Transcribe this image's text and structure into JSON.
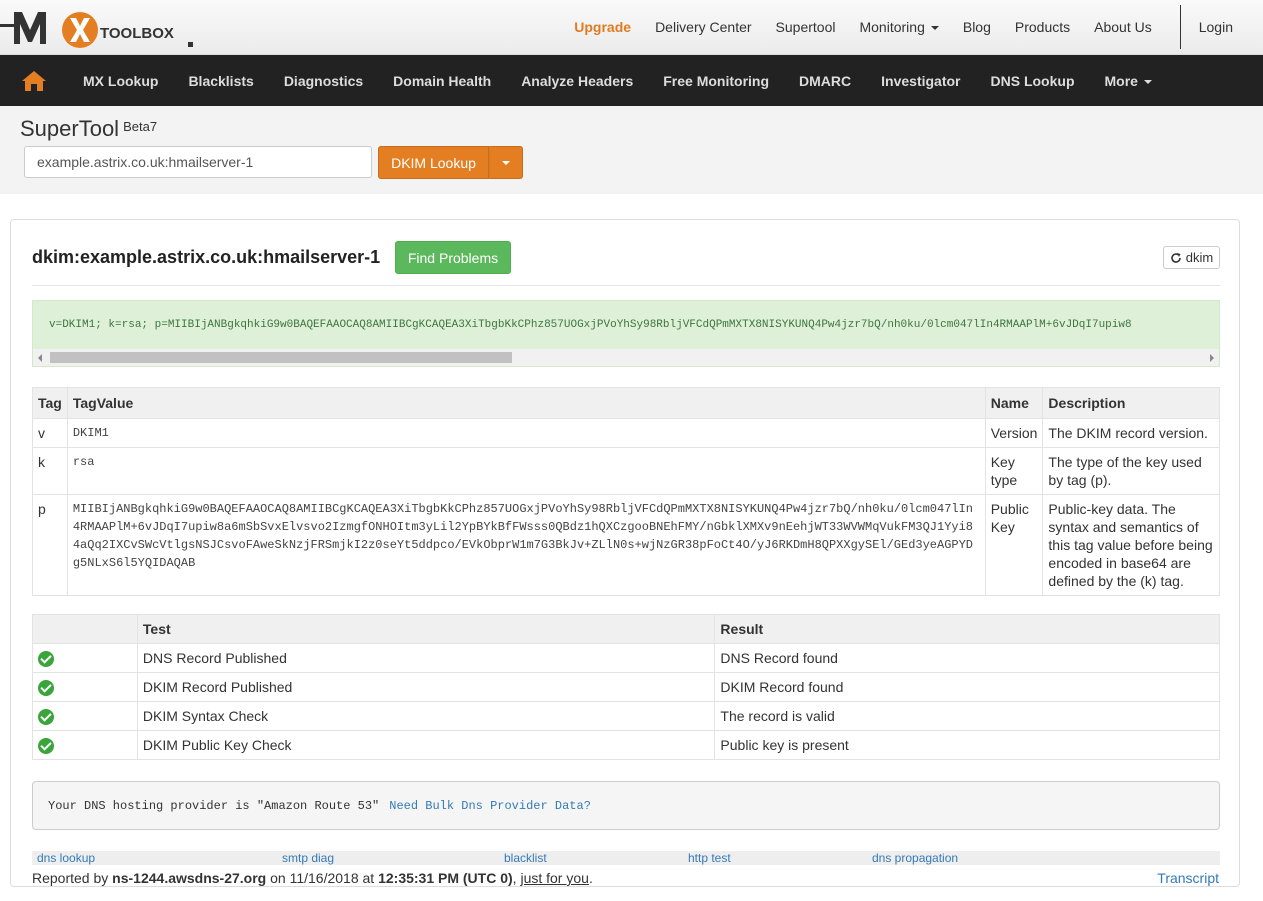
{
  "brand": {
    "logo_text": "TOOLBOX",
    "logo_letters": "MX"
  },
  "topnav": {
    "items": [
      "Upgrade",
      "Delivery Center",
      "Supertool",
      "Monitoring",
      "Blog",
      "Products",
      "About Us"
    ],
    "login": "Login"
  },
  "mainnav": {
    "items": [
      "MX Lookup",
      "Blacklists",
      "Diagnostics",
      "Domain Health",
      "Analyze Headers",
      "Free Monitoring",
      "DMARC",
      "Investigator",
      "DNS Lookup",
      "More"
    ]
  },
  "supertool": {
    "title": "SuperTool",
    "beta": "Beta7",
    "input_value": "example.astrix.co.uk:hmailserver-1",
    "button_label": "DKIM Lookup"
  },
  "result": {
    "title": "dkim:example.astrix.co.uk:hmailserver-1",
    "find_problems": "Find Problems",
    "refresh_label": "dkim",
    "record": "v=DKIM1; k=rsa; p=MIIBIjANBgkqhkiG9w0BAQEFAAOCAQ8AMIIBCgKCAQEA3XiTbgbKkCPhz857UOGxjPVoYhSy98RbljVFCdQPmMXTX8NISYKUNQ4Pw4jzr7bQ/nh0ku/0lcm047lIn4RMAAPlM+6vJDqI7upiw8"
  },
  "tag_table": {
    "headers": [
      "Tag",
      "TagValue",
      "Name",
      "Description"
    ],
    "rows": [
      {
        "tag": "v",
        "value": "DKIM1",
        "name": "Version",
        "description": "The DKIM record version."
      },
      {
        "tag": "k",
        "value": "rsa",
        "name": "Key type",
        "description": "The type of the key used by tag (p)."
      },
      {
        "tag": "p",
        "value": "MIIBIjANBgkqhkiG9w0BAQEFAAOCAQ8AMIIBCgKCAQEA3XiTbgbKkCPhz857UOGxjPVoYhSy98RbljVFCdQPmMXTX8NISYKUNQ4Pw4jzr7bQ/nh0ku/0lcm047lIn4RMAAPlM+6vJDqI7upiw8a6mSbSvxElvsvo2IzmgfONHOItm3yLil2YpBYkBfFWsss0QBdz1hQXCzgooBNEhFMY/nGbklXMXv9nEehjWT33WVWMqVukFM3QJ1Yyi84aQq2IXCvSWcVtlgsNSJCsvoFAweSkNzjFRSmjkI2z0seYt5ddpco/EVkObprW1m7G3BkJv+ZLlN0s+wjNzGR38pFoCt4O/yJ6RKDmH8QPXXgySEl/GEd3yeAGPYDg5NLxS6l5YQIDAQAB",
        "name": "Public Key",
        "description": "Public-key data. The syntax and semantics of this tag value before being encoded in base64 are defined by the (k) tag."
      }
    ]
  },
  "test_table": {
    "headers": [
      "",
      "Test",
      "Result"
    ],
    "rows": [
      {
        "test": "DNS Record Published",
        "result": "DNS Record found"
      },
      {
        "test": "DKIM Record Published",
        "result": "DKIM Record found"
      },
      {
        "test": "DKIM Syntax Check",
        "result": "The record is valid"
      },
      {
        "test": "DKIM Public Key Check",
        "result": "Public key is present"
      }
    ]
  },
  "provider": {
    "text": "Your DNS hosting provider is \"Amazon Route 53\"",
    "link": "Need Bulk Dns Provider Data?"
  },
  "footer": {
    "links": [
      "dns lookup",
      "smtp diag",
      "blacklist",
      "http test",
      "dns propagation"
    ],
    "reported_prefix": "Reported by ",
    "server": "ns-1244.awsdns-27.org",
    "on": " on 11/16/2018 at ",
    "time": "12:35:31 PM (UTC 0)",
    "comma": ", ",
    "just_for_you": "just for you",
    "period": ".",
    "transcript": "Transcript"
  },
  "colors": {
    "accent_orange": "#e47e22",
    "success_green": "#5cb85c",
    "nav_dark": "#222222",
    "link_blue": "#337ab7"
  }
}
